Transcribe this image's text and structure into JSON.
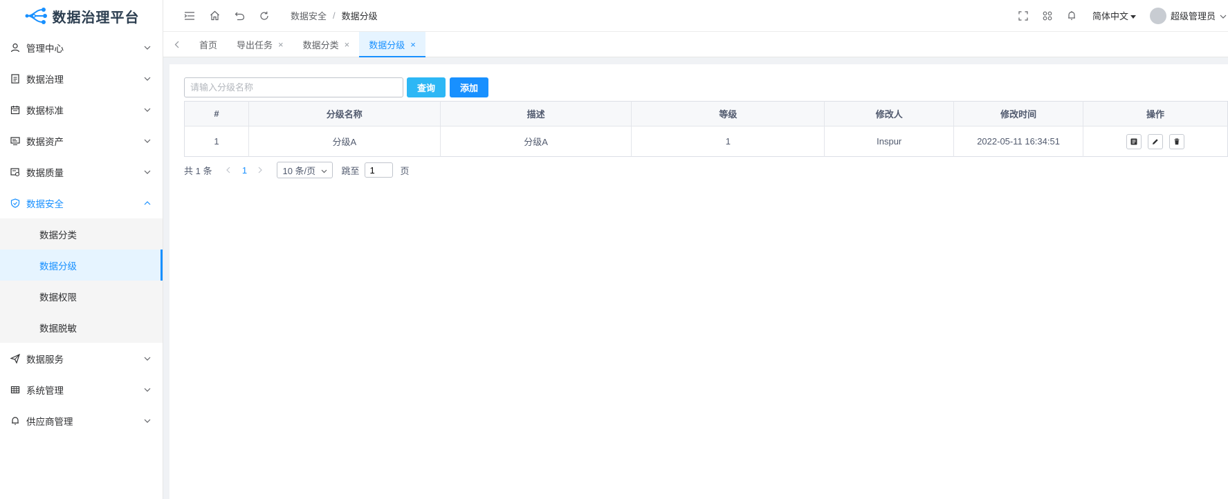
{
  "app": {
    "title": "数据治理平台"
  },
  "sidebar": {
    "items": [
      {
        "label": "管理中心",
        "icon": "user-icon"
      },
      {
        "label": "数据治理",
        "icon": "document-icon"
      },
      {
        "label": "数据标准",
        "icon": "calendar-icon"
      },
      {
        "label": "数据资产",
        "icon": "monitor-icon"
      },
      {
        "label": "数据质量",
        "icon": "quality-icon"
      },
      {
        "label": "数据安全",
        "icon": "shield-icon",
        "expanded": true,
        "children": [
          "数据分类",
          "数据分级",
          "数据权限",
          "数据脱敏"
        ],
        "active_child": "数据分级"
      },
      {
        "label": "数据服务",
        "icon": "send-icon"
      },
      {
        "label": "系统管理",
        "icon": "grid-icon"
      },
      {
        "label": "供应商管理",
        "icon": "bell-icon"
      }
    ]
  },
  "topbar": {
    "breadcrumb": {
      "parent": "数据安全",
      "separator": "/",
      "current": "数据分级"
    },
    "language": "简体中文",
    "user": "超级管理员"
  },
  "tabs": [
    {
      "label": "首页",
      "closable": false
    },
    {
      "label": "导出任务",
      "closable": true
    },
    {
      "label": "数据分类",
      "closable": true
    },
    {
      "label": "数据分级",
      "closable": true,
      "active": true
    }
  ],
  "tab_close_glyph": "×",
  "search": {
    "placeholder": "请输入分级名称",
    "value": ""
  },
  "buttons": {
    "query": "查询",
    "add": "添加"
  },
  "table": {
    "columns": [
      "#",
      "分级名称",
      "描述",
      "等级",
      "修改人",
      "修改时间",
      "操作"
    ],
    "rows": [
      {
        "index": "1",
        "name": "分级A",
        "description": "分级A",
        "level": "1",
        "modifier": "Inspur",
        "modified_time": "2022-05-11 16:34:51"
      }
    ]
  },
  "pagination": {
    "total": "共 1 条",
    "current_page": "1",
    "page_size": "10 条/页",
    "jump_label": "跳至",
    "jump_value": "1",
    "page_suffix": "页"
  },
  "colors": {
    "primary": "#1890ff",
    "query_button": "#2db7f5",
    "active_bg": "#e6f4ff"
  }
}
